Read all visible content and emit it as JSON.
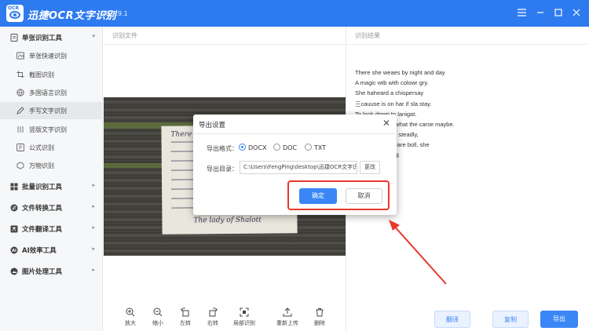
{
  "app": {
    "title": "迅捷OCR文字识别",
    "version": "v8.7.9.1",
    "logo_text": "OCR",
    "brand_color": "#2e7bf0"
  },
  "window_controls": [
    "menu-icon",
    "minimize-icon",
    "maximize-icon",
    "close-icon"
  ],
  "sidebar": {
    "groups": [
      {
        "label": "单张识别工具",
        "icon": "doc-icon",
        "expanded": true,
        "items": [
          {
            "label": "单张快速识别",
            "icon": "image-icon"
          },
          {
            "label": "截图识别",
            "icon": "crop-icon"
          },
          {
            "label": "多国语言识别",
            "icon": "globe-icon"
          },
          {
            "label": "手写文字识别",
            "icon": "pen-icon",
            "active": true
          },
          {
            "label": "竖版文字识别",
            "icon": "vertical-text-icon"
          },
          {
            "label": "公式识别",
            "icon": "formula-icon"
          },
          {
            "label": "万物识别",
            "icon": "objects-icon"
          }
        ]
      },
      {
        "label": "批量识别工具",
        "icon": "batch-icon"
      },
      {
        "label": "文件转换工具",
        "icon": "convert-icon"
      },
      {
        "label": "文件翻译工具",
        "icon": "translate-icon"
      },
      {
        "label": "AI效率工具",
        "icon": "ai-icon"
      },
      {
        "label": "图片处理工具",
        "icon": "picture-icon"
      }
    ]
  },
  "main": {
    "left_header": "识别文件",
    "right_header": "识别结果",
    "toolbar": [
      {
        "label": "放大",
        "icon": "zoom-in-icon"
      },
      {
        "label": "缩小",
        "icon": "zoom-out-icon"
      },
      {
        "label": "左转",
        "icon": "rotate-left-icon"
      },
      {
        "label": "右转",
        "icon": "rotate-right-icon"
      },
      {
        "label": "局部识别",
        "icon": "partial-icon"
      },
      {
        "label": "重新上传",
        "icon": "upload-icon"
      },
      {
        "label": "删除",
        "icon": "trash-icon"
      }
    ],
    "result_lines": [
      "There she weaes by night and day",
      "A magic wtb with colowr gry.",
      "She haheard a chispersay",
      "三cauuse is on har if sla stay.",
      "To look down to lanigat.",
      "She knows not what the carse maybe.",
      "And so she waft steadly,",
      "And little other care boll, she",
      "The lady of Shall"
    ],
    "result_buttons": {
      "translate": "翻译",
      "copy": "复制",
      "export": "导出"
    }
  },
  "dialog": {
    "title": "导出设置",
    "format_label": "导出格式：",
    "formats": [
      {
        "label": "DOCX",
        "selected": true
      },
      {
        "label": "DOC",
        "selected": false
      },
      {
        "label": "TXT",
        "selected": false
      }
    ],
    "dir_label": "导出目录：",
    "dir_value": "C:\\Users\\FengPing\\desktop\\迅捷OCR文字识别",
    "change_label": "更改",
    "ok_label": "确定",
    "cancel_label": "取消",
    "highlight_color": "#e8372c"
  }
}
